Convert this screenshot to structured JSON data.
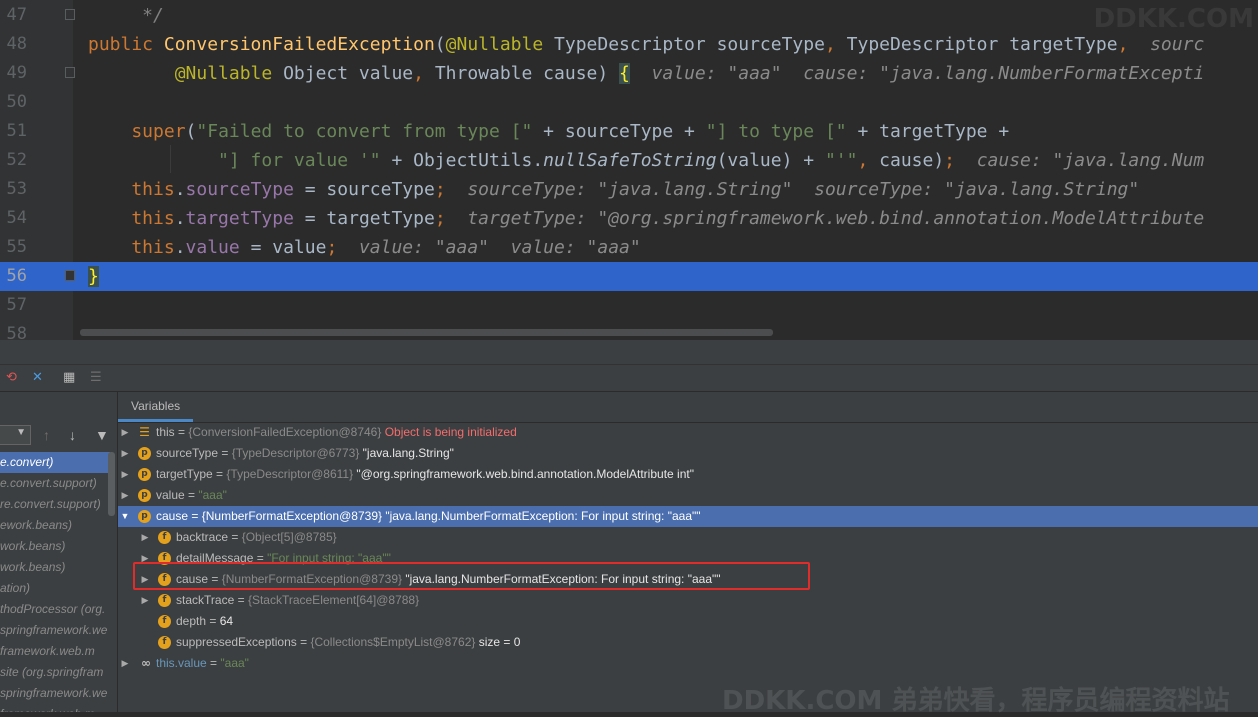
{
  "editor": {
    "lines": [
      {
        "num": "47",
        "parts": [
          {
            "t": "     */",
            "c": "cmt"
          }
        ]
      },
      {
        "num": "48",
        "parts": [
          {
            "t": "public ",
            "c": "kw"
          },
          {
            "t": "ConversionFailedException",
            "c": "fn"
          },
          {
            "t": "(",
            "c": ""
          },
          {
            "t": "@Nullable ",
            "c": "ann"
          },
          {
            "t": "TypeDescriptor sourceType",
            "c": ""
          },
          {
            "t": ", ",
            "c": "kw"
          },
          {
            "t": "TypeDescriptor targetType",
            "c": ""
          },
          {
            "t": ",  ",
            "c": "kw"
          },
          {
            "t": "sourc",
            "c": "hint"
          }
        ]
      },
      {
        "num": "49",
        "parts": [
          {
            "t": "        @Nullable ",
            "c": "ann"
          },
          {
            "t": "Object value",
            "c": ""
          },
          {
            "t": ", ",
            "c": "kw"
          },
          {
            "t": "Throwable cause) ",
            "c": ""
          },
          {
            "t": "{",
            "c": "brace-hl"
          },
          {
            "t": "  value: \"aaa\"  cause: \"java.lang.NumberFormatExcepti",
            "c": "hint"
          }
        ]
      },
      {
        "num": "50",
        "parts": []
      },
      {
        "num": "51",
        "parts": [
          {
            "t": "    super",
            "c": "kw"
          },
          {
            "t": "(",
            "c": ""
          },
          {
            "t": "\"Failed to convert from type [\"",
            "c": "str"
          },
          {
            "t": " + sourceType + ",
            "c": ""
          },
          {
            "t": "\"] to type [\"",
            "c": "str"
          },
          {
            "t": " + targetType +",
            "c": ""
          }
        ]
      },
      {
        "num": "52",
        "parts": [
          {
            "t": "            ",
            "c": ""
          },
          {
            "t": "\"] for value '\"",
            "c": "str"
          },
          {
            "t": " + ObjectUtils.",
            "c": ""
          },
          {
            "t": "nullSafeToString",
            "c": "it"
          },
          {
            "t": "(value) + ",
            "c": ""
          },
          {
            "t": "\"'\"",
            "c": "str"
          },
          {
            "t": ", ",
            "c": "kw"
          },
          {
            "t": "cause)",
            "c": ""
          },
          {
            "t": ";",
            "c": "kw"
          },
          {
            "t": "  cause: \"java.lang.Num",
            "c": "hint"
          }
        ]
      },
      {
        "num": "53",
        "parts": [
          {
            "t": "    this",
            "c": "kw"
          },
          {
            "t": ".",
            "c": ""
          },
          {
            "t": "sourceType",
            "c": "fld"
          },
          {
            "t": " = sourceType",
            "c": ""
          },
          {
            "t": ";",
            "c": "kw"
          },
          {
            "t": "  sourceType: \"java.lang.String\"  sourceType: \"java.lang.String\"",
            "c": "hint"
          }
        ]
      },
      {
        "num": "54",
        "parts": [
          {
            "t": "    this",
            "c": "kw"
          },
          {
            "t": ".",
            "c": ""
          },
          {
            "t": "targetType",
            "c": "fld"
          },
          {
            "t": " = targetType",
            "c": ""
          },
          {
            "t": ";",
            "c": "kw"
          },
          {
            "t": "  targetType: \"@org.springframework.web.bind.annotation.ModelAttribute",
            "c": "hint"
          }
        ]
      },
      {
        "num": "55",
        "parts": [
          {
            "t": "    this",
            "c": "kw"
          },
          {
            "t": ".",
            "c": ""
          },
          {
            "t": "value",
            "c": "fld"
          },
          {
            "t": " = value",
            "c": ""
          },
          {
            "t": ";",
            "c": "kw"
          },
          {
            "t": "  value: \"aaa\"  value: \"aaa\"",
            "c": "hint"
          }
        ]
      },
      {
        "num": "56",
        "current": true,
        "parts": [
          {
            "t": "}",
            "c": "brace-hl"
          }
        ]
      },
      {
        "num": "57",
        "parts": []
      },
      {
        "num": "58",
        "parts": []
      }
    ]
  },
  "debug": {
    "toolbar_icons": [
      "restore-layout-icon",
      "remove-icon",
      "table-icon",
      "settings-icon"
    ],
    "variables_tab": "Variables",
    "frames": [
      {
        "label": "e.convert)",
        "selected": true
      },
      {
        "label": "e.convert.support)"
      },
      {
        "label": "re.convert.support)"
      },
      {
        "label": "ework.beans)"
      },
      {
        "label": "work.beans)"
      },
      {
        "label": "work.beans)"
      },
      {
        "label": "ation)"
      },
      {
        "label": "thodProcessor (org."
      },
      {
        "label": "springframework.we"
      },
      {
        "label": "framework.web.m"
      },
      {
        "label": "site (org.springfram"
      },
      {
        "label": "springframework.we"
      },
      {
        "label": "framework.web.m"
      }
    ],
    "variables": [
      {
        "indent": 0,
        "toggle": "▶",
        "icon": "stack",
        "name": "this",
        "eq": " = ",
        "type": "{ConversionFailedException@8746} ",
        "val": "Object is being initialized",
        "valclass": "err"
      },
      {
        "indent": 0,
        "toggle": "▶",
        "icon": "p",
        "name": "sourceType",
        "eq": " = ",
        "type": "{TypeDescriptor@6773} ",
        "val": "\"java.lang.String\""
      },
      {
        "indent": 0,
        "toggle": "▶",
        "icon": "p",
        "name": "targetType",
        "eq": " = ",
        "type": "{TypeDescriptor@8611} ",
        "val": "\"@org.springframework.web.bind.annotation.ModelAttribute int\""
      },
      {
        "indent": 0,
        "toggle": "▶",
        "icon": "p",
        "name": "value",
        "eq": " = ",
        "type": "",
        "val": "\"aaa\"",
        "valclass": "str"
      },
      {
        "indent": 0,
        "toggle": "▼",
        "icon": "p",
        "name": "cause",
        "eq": " = ",
        "type": "{NumberFormatException@8739} ",
        "val": "\"java.lang.NumberFormatException: For input string: \"aaa\"\"",
        "selected": true
      },
      {
        "indent": 1,
        "toggle": "▶",
        "icon": "f",
        "name": "backtrace",
        "eq": " = ",
        "type": "{Object[5]@8785}",
        "val": ""
      },
      {
        "indent": 1,
        "toggle": "▶",
        "icon": "f",
        "name": "detailMessage",
        "eq": " = ",
        "type": "",
        "val": "\"For input string: \"aaa\"\"",
        "valclass": "str"
      },
      {
        "indent": 1,
        "toggle": "▶",
        "icon": "f",
        "name": "cause",
        "eq": " = ",
        "type": "{NumberFormatException@8739} ",
        "val": "\"java.lang.NumberFormatException: For input string: \"aaa\"\""
      },
      {
        "indent": 1,
        "toggle": "▶",
        "icon": "f",
        "name": "stackTrace",
        "eq": " = ",
        "type": "{StackTraceElement[64]@8788}",
        "val": ""
      },
      {
        "indent": 1,
        "toggle": "",
        "icon": "f",
        "name": "depth",
        "eq": " = ",
        "type": "",
        "val": "64"
      },
      {
        "indent": 1,
        "toggle": "",
        "icon": "f",
        "name": "suppressedExceptions",
        "eq": " = ",
        "type": "{Collections$EmptyList@8762}",
        "val": "  size = 0"
      },
      {
        "indent": 0,
        "toggle": "▶",
        "icon": "watch",
        "name": "this.value",
        "nameclass": "blue",
        "eq": " = ",
        "type": "",
        "val": "\"aaa\"",
        "valclass": "str"
      }
    ]
  },
  "watermark": {
    "top": "DDKK.COM",
    "bottom": "DDKK.COM 弟弟快看，程序员编程资料站"
  }
}
